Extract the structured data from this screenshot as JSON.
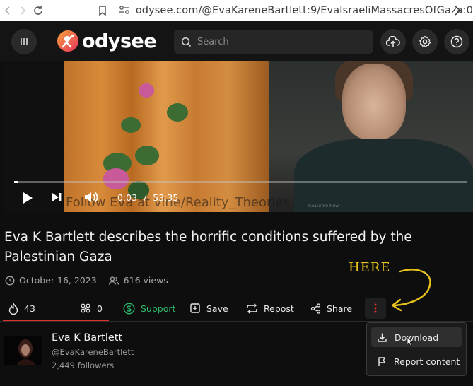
{
  "browser": {
    "url": "odysee.com/@EvaKareneBartlett:9/EvaIsraeliMassacresOfGaza:0"
  },
  "header": {
    "logo_text": "odysee",
    "search_placeholder": "Search"
  },
  "video": {
    "current_time": "0:03",
    "separator": "/",
    "duration": "53:35",
    "progress": 0.001,
    "watermark": "Follow Eva at vine/Reality_Theories",
    "watermark_small": "Ceasefire Now"
  },
  "title": "Eva K Bartlett describes the horrific conditions suffered by the Palestinian Gaza",
  "meta": {
    "date": "October 16, 2023",
    "views": "616 views"
  },
  "annotation": "HERE",
  "actions": {
    "fire_count": "43",
    "slime_count": "0",
    "support_label": "Support",
    "save_label": "Save",
    "repost_label": "Repost",
    "share_label": "Share"
  },
  "channel": {
    "name": "Eva K Bartlett",
    "handle": "@EvaKareneBartlett",
    "followers": "2,449 followers"
  },
  "menu": {
    "items": [
      {
        "label": "Download",
        "icon": "download-icon"
      },
      {
        "label": "Report content",
        "icon": "flag-icon"
      }
    ]
  },
  "colors": {
    "accent": "#e0332e",
    "support": "#2bbb6e",
    "annotation": "#e6c21c",
    "logo_orange": "#f25b24"
  }
}
